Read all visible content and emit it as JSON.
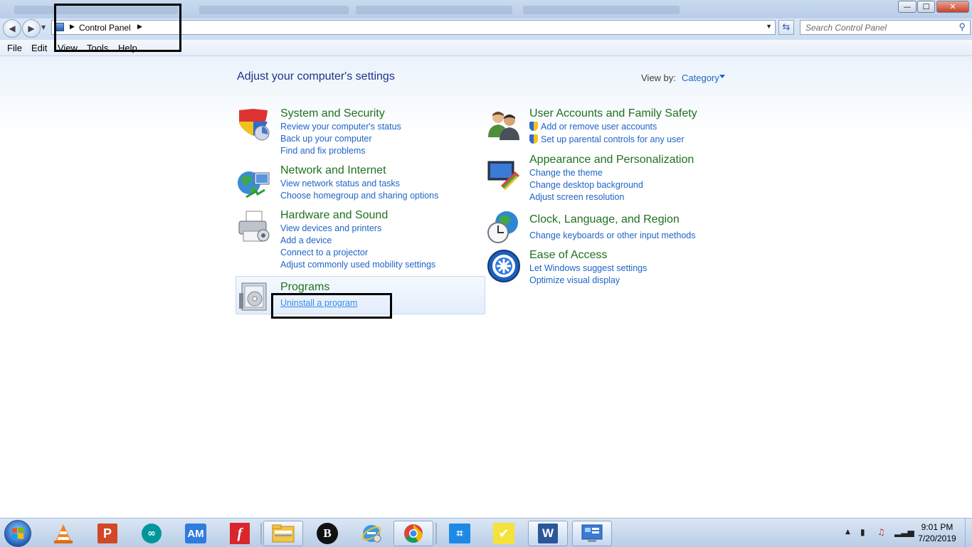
{
  "window": {
    "minimize_glyph": "—",
    "maximize_glyph": "☐",
    "close_glyph": "✕"
  },
  "address_bar": {
    "breadcrumb": "Control Panel",
    "search_placeholder": "Search Control Panel"
  },
  "menu": {
    "file": "File",
    "edit": "Edit",
    "view": "View",
    "tools": "Tools",
    "help": "Help"
  },
  "main": {
    "title": "Adjust your computer's settings",
    "view_by_label": "View by:",
    "view_by_value": "Category"
  },
  "categories": {
    "system_security": {
      "title": "System and Security",
      "links": [
        "Review your computer's status",
        "Back up your computer",
        "Find and fix problems"
      ]
    },
    "network": {
      "title": "Network and Internet",
      "links": [
        "View network status and tasks",
        "Choose homegroup and sharing options"
      ]
    },
    "hardware": {
      "title": "Hardware and Sound",
      "links": [
        "View devices and printers",
        "Add a device",
        "Connect to a projector",
        "Adjust commonly used mobility settings"
      ]
    },
    "programs": {
      "title": "Programs",
      "links": [
        "Uninstall a program"
      ]
    },
    "user_accounts": {
      "title": "User Accounts and Family Safety",
      "links": [
        "Add or remove user accounts",
        "Set up parental controls for any user"
      ]
    },
    "appearance": {
      "title": "Appearance and Personalization",
      "links": [
        "Change the theme",
        "Change desktop background",
        "Adjust screen resolution"
      ]
    },
    "clock": {
      "title": "Clock, Language, and Region",
      "links": [
        "Change keyboards or other input methods"
      ]
    },
    "ease": {
      "title": "Ease of Access",
      "links": [
        "Let Windows suggest settings",
        "Optimize visual display"
      ]
    }
  },
  "taskbar": {
    "apps": [
      "vlc-icon",
      "powerpoint-icon",
      "arduino-icon",
      "am-icon",
      "foxit-icon",
      "file-explorer-icon",
      "b-icon",
      "ie-icon",
      "chrome-icon",
      "snip-icon",
      "sticky-notes-icon",
      "word-icon",
      "control-panel-icon"
    ],
    "am_label": "AM",
    "b_label": "B",
    "word_label": "W",
    "ppt_label": "P",
    "foxit_label": "f",
    "clock_time": "9:01 PM",
    "clock_date": "7/20/2019"
  },
  "colors": {
    "category_title": "#207020",
    "link": "#1e64c8",
    "heading": "#1e3287"
  }
}
